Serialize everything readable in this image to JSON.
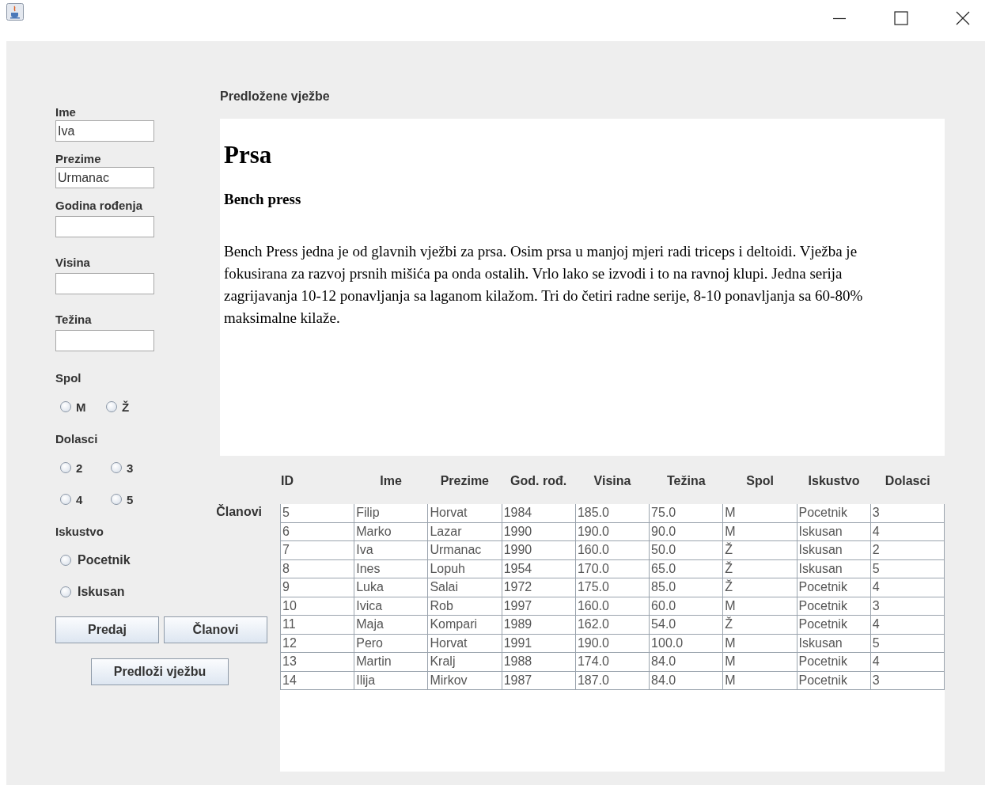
{
  "form": {
    "fields": [
      {
        "label": "Ime",
        "value": "Iva"
      },
      {
        "label": "Prezime",
        "value": "Urmanac"
      },
      {
        "label": "Godina rođenja"
      },
      {
        "label": "Visina"
      },
      {
        "label": "Težina"
      }
    ],
    "groups": [
      {
        "label": "Spol",
        "kind": "row",
        "options": [
          {
            "label": "M",
            "selected": false
          },
          {
            "label": "Ž",
            "selected": false
          }
        ]
      },
      {
        "label": "Dolasci",
        "kind": "grid",
        "options": [
          {
            "label": "2",
            "selected": false
          },
          {
            "label": "3",
            "selected": false
          },
          {
            "label": "4",
            "selected": false
          },
          {
            "label": "5",
            "selected": false
          }
        ]
      },
      {
        "label": "Iskustvo",
        "kind": "column",
        "options": [
          {
            "label": "Pocetnik",
            "selected": false
          },
          {
            "label": "Iskusan",
            "selected": false
          }
        ]
      }
    ],
    "buttons": [
      "Predaj",
      "Članovi"
    ],
    "suggest_button": "Predloži vježbu"
  },
  "exercise": {
    "heading": "Predložene vježbe",
    "title": "Prsa",
    "subtitle": "Bench press",
    "body": "Bench Press jedna je od glavnih vježbi za prsa. Osim prsa u manjoj mjeri radi triceps i deltoidi. Vježba je fokusirana za razvoj prsnih mišića pa onda ostalih. Vrlo lako se izvodi i to na ravnoj klupi. Jedna serija zagrijavanja 10-12 ponavljanja sa laganom kilažom. Tri do četiri radne serije, 8-10 ponavljanja sa 60-80% maksimalne kilaže."
  },
  "members": {
    "label": "Članovi",
    "columns": [
      "ID",
      "Ime",
      "Prezime",
      "God. rođ.",
      "Visina",
      "Težina",
      "Spol",
      "Iskustvo",
      "Dolasci"
    ],
    "rows": [
      [
        "5",
        "Filip",
        "Horvat",
        "1984",
        "185.0",
        "75.0",
        "M",
        "Pocetnik",
        "3"
      ],
      [
        "6",
        "Marko",
        "Lazar",
        "1990",
        "190.0",
        "90.0",
        "M",
        "Iskusan",
        "4"
      ],
      [
        "7",
        "Iva",
        "Urmanac",
        "1990",
        "160.0",
        "50.0",
        "Ž",
        "Iskusan",
        "2"
      ],
      [
        "8",
        "Ines",
        "Lopuh",
        "1954",
        "170.0",
        "65.0",
        "Ž",
        "Iskusan",
        "5"
      ],
      [
        "9",
        "Luka",
        "Salai",
        "1972",
        "175.0",
        "85.0",
        "Ž",
        "Pocetnik",
        "4"
      ],
      [
        "10",
        "Ivica",
        "Rob",
        "1997",
        "160.0",
        "60.0",
        "M",
        "Pocetnik",
        "3"
      ],
      [
        "11",
        "Maja",
        "Kompari",
        "1989",
        "162.0",
        "54.0",
        "Ž",
        "Pocetnik",
        "4"
      ],
      [
        "12",
        "Pero",
        "Horvat",
        "1991",
        "190.0",
        "100.0",
        "M",
        "Iskusan",
        "5"
      ],
      [
        "13",
        "Martin",
        "Kralj",
        "1988",
        "174.0",
        "84.0",
        "M",
        "Pocetnik",
        "4"
      ],
      [
        "14",
        "Ilija",
        "Mirkov",
        "1987",
        "187.0",
        "84.0",
        "M",
        "Pocetnik",
        "3"
      ]
    ]
  }
}
